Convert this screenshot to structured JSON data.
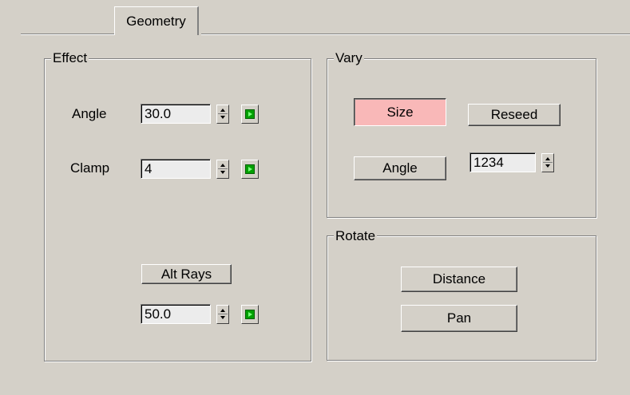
{
  "tabs": [
    {
      "label": "Geometry",
      "active": true
    }
  ],
  "effect": {
    "title": "Effect",
    "angle": {
      "label": "Angle",
      "value": "30.0"
    },
    "clamp": {
      "label": "Clamp",
      "value": "4"
    },
    "alt_rays": {
      "label": "Alt Rays",
      "value": "50.0"
    }
  },
  "vary": {
    "title": "Vary",
    "size_label": "Size",
    "size_active": true,
    "reseed_label": "Reseed",
    "angle_label": "Angle",
    "seed_value": "1234"
  },
  "rotate": {
    "title": "Rotate",
    "distance_label": "Distance",
    "pan_label": "Pan"
  },
  "colors": {
    "panel_bg": "#d4d0c8",
    "active_button_bg": "#f9b8b8",
    "anim_key_green": "#00a000"
  },
  "icons": [
    "spinner-arrows-icon",
    "animate-key-icon"
  ]
}
